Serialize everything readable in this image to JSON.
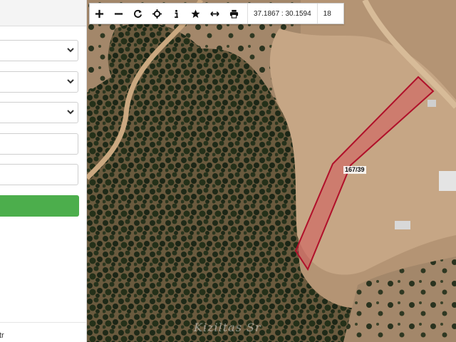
{
  "toolbar": {
    "icons": [
      "zoom-in-icon",
      "zoom-out-icon",
      "refresh-icon",
      "locate-icon",
      "info-icon",
      "star-icon",
      "measure-icon",
      "print-icon"
    ],
    "coordinates": "37.1867 : 30.1594",
    "zoom_level": "18"
  },
  "map": {
    "parcel_label": "167/39",
    "parcel_outline_color": "#b0102a",
    "watermark": "Kiziltas Sr"
  },
  "sidebar": {
    "footer_text": "tr",
    "button_color": "#4cae4c"
  }
}
